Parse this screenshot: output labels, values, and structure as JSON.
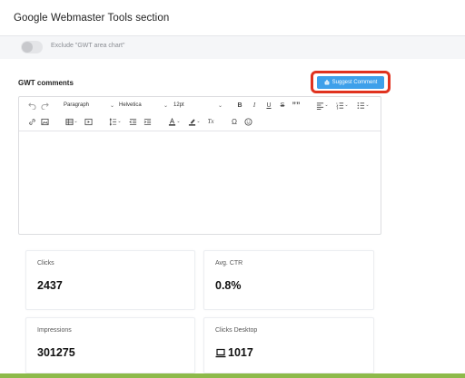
{
  "header": {
    "title": "Google Webmaster Tools section"
  },
  "exclude_toggle": {
    "label": "Exclude \"GWT area chart\"",
    "checked": false
  },
  "comments": {
    "section_label": "GWT comments",
    "suggest_button": "Suggest Comment",
    "toolbar": {
      "paragraph": "Paragraph",
      "font": "Helvetica",
      "size": "12pt",
      "bold": "B",
      "italic": "I",
      "underline": "U",
      "strike": "S",
      "quote": "””",
      "omega": "Ω",
      "clear_format": "Tx"
    }
  },
  "metrics": [
    {
      "label": "Clicks",
      "value": "2437"
    },
    {
      "label": "Avg. CTR",
      "value": "0.8%"
    },
    {
      "label": "Impressions",
      "value": "301275"
    },
    {
      "label": "Clicks Desktop",
      "value": "1017",
      "icon": "laptop-icon"
    }
  ],
  "colors": {
    "accent": "#3ea0ea",
    "highlight": "#e0321f",
    "footer_bar": "#8dba4a"
  }
}
